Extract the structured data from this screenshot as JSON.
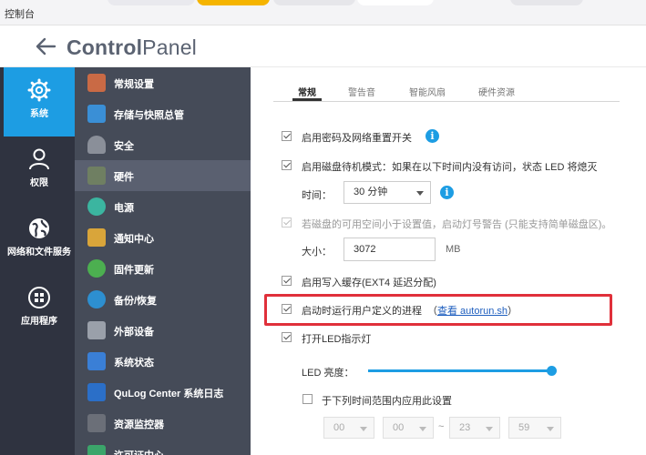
{
  "window": {
    "title": "控制台"
  },
  "header": {
    "title_bold": "Control",
    "title_rest": "Panel"
  },
  "leftnav": [
    {
      "label": "系统",
      "icon": "gear-icon",
      "active": true
    },
    {
      "label": "权限",
      "icon": "user-icon",
      "active": false
    },
    {
      "label": "网络和文件服务",
      "icon": "globe-icon",
      "active": false
    },
    {
      "label": "应用程序",
      "icon": "apps-grid-icon",
      "active": false
    }
  ],
  "subnav": [
    {
      "label": "常规设置",
      "icon": "general-settings-icon",
      "color": "#c96a45"
    },
    {
      "label": "存储与快照总管",
      "icon": "storage-icon",
      "color": "#3a8fd6"
    },
    {
      "label": "安全",
      "icon": "lock-icon",
      "color": "#8a8f99"
    },
    {
      "label": "硬件",
      "icon": "hardware-icon",
      "color": "#6f7f62",
      "active": true
    },
    {
      "label": "电源",
      "icon": "power-bulb-icon",
      "color": "#3bb5a0"
    },
    {
      "label": "通知中心",
      "icon": "notification-icon",
      "color": "#d9a53a"
    },
    {
      "label": "固件更新",
      "icon": "firmware-update-icon",
      "color": "#4caf50"
    },
    {
      "label": "备份/恢复",
      "icon": "backup-restore-icon",
      "color": "#2d8fd0"
    },
    {
      "label": "外部设备",
      "icon": "external-device-icon",
      "color": "#9aa0aa"
    },
    {
      "label": "系统状态",
      "icon": "system-status-icon",
      "color": "#3a7fd6"
    },
    {
      "label": "QuLog Center 系统日志",
      "icon": "qulog-icon",
      "color": "#2b6fc8"
    },
    {
      "label": "资源监控器",
      "icon": "resource-monitor-icon",
      "color": "#6b6f78"
    },
    {
      "label": "许可证中心",
      "icon": "license-icon",
      "color": "#3ba56a"
    }
  ],
  "tabs": [
    {
      "label": "常规",
      "active": true
    },
    {
      "label": "警告音",
      "active": false
    },
    {
      "label": "智能风扇",
      "active": false
    },
    {
      "label": "硬件资源",
      "active": false
    }
  ],
  "settings": {
    "reset_switch": "启用密码及网络重置开关",
    "disk_standby": "启用磁盘待机模式：如果在以下时间内没有访问，状态 LED 将熄灭",
    "time_label": "时间：",
    "time_value": "30 分钟",
    "low_space_warning": "若磁盘的可用空间小于设置值，启动灯号警告 (只能支持简单磁盘区)。",
    "size_label": "大小：",
    "size_value": "3072",
    "size_unit": "MB",
    "write_cache": "启用写入缓存(EXT4 延迟分配)",
    "user_process": "启动时运行用户定义的进程",
    "user_process_link_open": "（",
    "user_process_link": "查看 autorun.sh",
    "user_process_link_close": "）",
    "led_indicator": "打开LED指示灯",
    "led_brightness_label": "LED 亮度：",
    "led_brightness_value": 1.0,
    "schedule_label": "于下列时间范围内应用此设置",
    "schedule_from_hour": "00",
    "schedule_from_min": "00",
    "schedule_sep": "~",
    "schedule_to_hour": "23",
    "schedule_to_min": "59"
  },
  "colors": {
    "accent": "#1d9de3",
    "highlight": "#e0303a",
    "nav_bg": "#2f3340",
    "subnav_bg": "#454b58"
  }
}
